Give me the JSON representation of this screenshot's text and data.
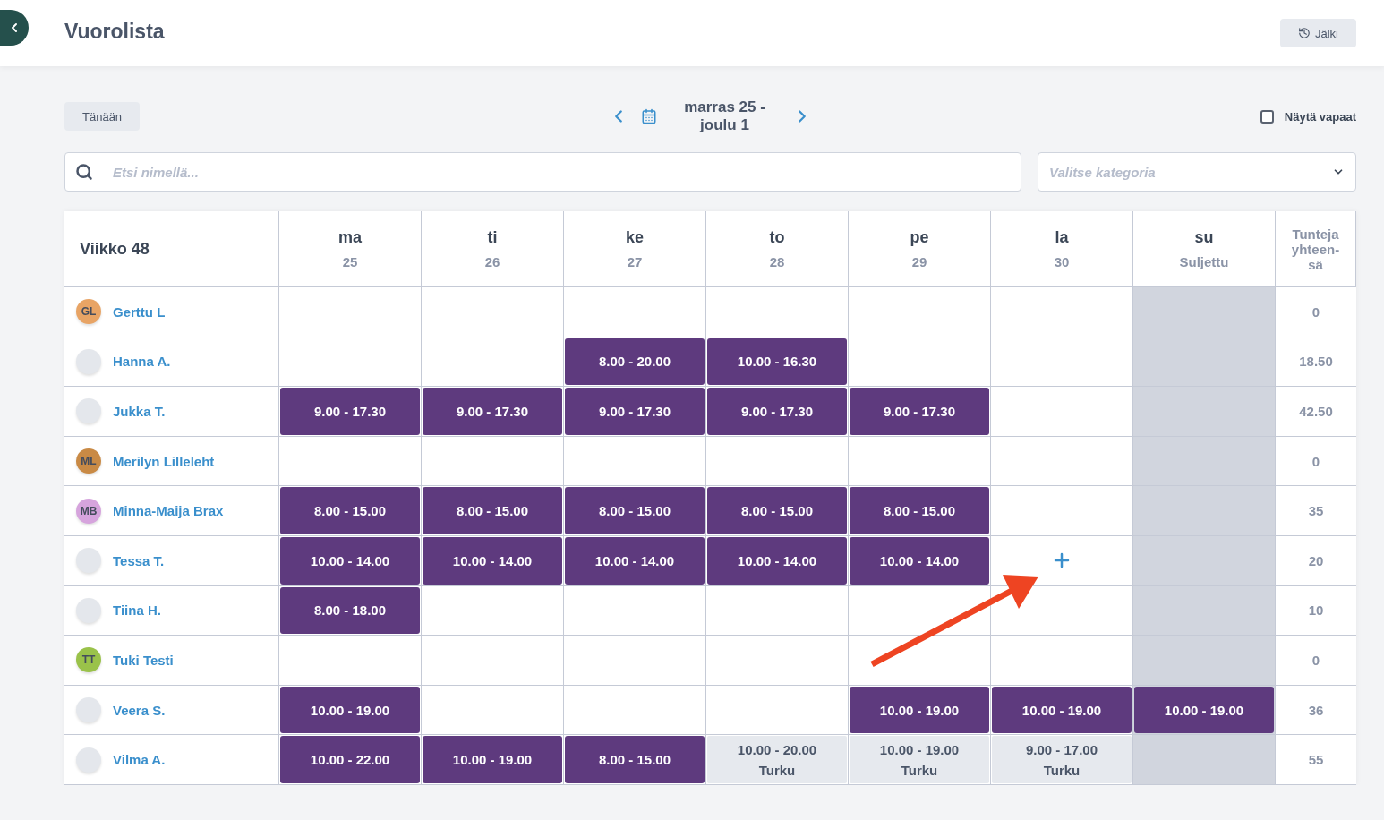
{
  "header": {
    "title": "Vuorolista",
    "history_button": "Jälki"
  },
  "toolbar": {
    "today_button": "Tänään",
    "date_range": [
      "marras 25 -",
      "joulu 1"
    ],
    "show_free": {
      "label": "Näytä vapaat",
      "checked": false
    }
  },
  "search": {
    "placeholder": "Etsi nimellä..."
  },
  "category_select": {
    "placeholder": "Valitse kategoria"
  },
  "table": {
    "week_label": "Viikko 48",
    "total_header": "Tunteja yhteen-sä",
    "days": [
      {
        "name": "ma",
        "sub": "25",
        "closed": false
      },
      {
        "name": "ti",
        "sub": "26",
        "closed": false
      },
      {
        "name": "ke",
        "sub": "27",
        "closed": false
      },
      {
        "name": "to",
        "sub": "28",
        "closed": false
      },
      {
        "name": "pe",
        "sub": "29",
        "closed": false
      },
      {
        "name": "la",
        "sub": "30",
        "closed": false
      },
      {
        "name": "su",
        "sub": "Suljettu",
        "closed": true
      }
    ],
    "rows": [
      {
        "name": "Gerttu L",
        "avatar": {
          "kind": "initials",
          "initials": "GL",
          "color": "#e8a465"
        },
        "cells": [
          null,
          null,
          null,
          null,
          null,
          null,
          null
        ],
        "total": "0"
      },
      {
        "name": "Hanna A.",
        "avatar": {
          "kind": "photo"
        },
        "cells": [
          null,
          null,
          {
            "kind": "shift",
            "time": "8.00 - 20.00"
          },
          {
            "kind": "shift",
            "time": "10.00 - 16.30"
          },
          null,
          null,
          null
        ],
        "total": "18.50"
      },
      {
        "name": "Jukka T.",
        "avatar": {
          "kind": "photo"
        },
        "cells": [
          {
            "kind": "shift",
            "time": "9.00 - 17.30"
          },
          {
            "kind": "shift",
            "time": "9.00 - 17.30"
          },
          {
            "kind": "shift",
            "time": "9.00 - 17.30"
          },
          {
            "kind": "shift",
            "time": "9.00 - 17.30"
          },
          {
            "kind": "shift",
            "time": "9.00 - 17.30"
          },
          null,
          null
        ],
        "total": "42.50"
      },
      {
        "name": "Merilyn Lilleleht",
        "avatar": {
          "kind": "initials",
          "initials": "ML",
          "color": "#c98a45"
        },
        "cells": [
          null,
          null,
          null,
          null,
          null,
          null,
          null
        ],
        "total": "0"
      },
      {
        "name": "Minna-Maija Brax",
        "avatar": {
          "kind": "initials",
          "initials": "MB",
          "color": "#d6a4dd"
        },
        "cells": [
          {
            "kind": "shift",
            "time": "8.00 - 15.00"
          },
          {
            "kind": "shift",
            "time": "8.00 - 15.00"
          },
          {
            "kind": "shift",
            "time": "8.00 - 15.00"
          },
          {
            "kind": "shift",
            "time": "8.00 - 15.00"
          },
          {
            "kind": "shift",
            "time": "8.00 - 15.00"
          },
          null,
          null
        ],
        "total": "35"
      },
      {
        "name": "Tessa T.",
        "avatar": {
          "kind": "photo"
        },
        "cells": [
          {
            "kind": "shift",
            "time": "10.00 - 14.00"
          },
          {
            "kind": "shift",
            "time": "10.00 - 14.00"
          },
          {
            "kind": "shift",
            "time": "10.00 - 14.00"
          },
          {
            "kind": "shift",
            "time": "10.00 - 14.00"
          },
          {
            "kind": "shift",
            "time": "10.00 - 14.00"
          },
          {
            "kind": "add"
          },
          null
        ],
        "total": "20"
      },
      {
        "name": "Tiina H.",
        "avatar": {
          "kind": "photo"
        },
        "cells": [
          {
            "kind": "shift",
            "time": "8.00 - 18.00"
          },
          null,
          null,
          null,
          null,
          null,
          null
        ],
        "total": "10"
      },
      {
        "name": "Tuki Testi",
        "avatar": {
          "kind": "initials",
          "initials": "TT",
          "color": "#9ac24a"
        },
        "cells": [
          null,
          null,
          null,
          null,
          null,
          null,
          null
        ],
        "total": "0"
      },
      {
        "name": "Veera S.",
        "avatar": {
          "kind": "photo"
        },
        "cells": [
          {
            "kind": "shift",
            "time": "10.00 - 19.00"
          },
          null,
          null,
          null,
          {
            "kind": "shift",
            "time": "10.00 - 19.00"
          },
          {
            "kind": "shift",
            "time": "10.00 - 19.00"
          },
          {
            "kind": "shift",
            "time": "10.00 - 19.00"
          }
        ],
        "total": "36"
      },
      {
        "name": "Vilma A.",
        "avatar": {
          "kind": "photo"
        },
        "cells": [
          {
            "kind": "shift",
            "time": "10.00 - 22.00"
          },
          {
            "kind": "shift",
            "time": "10.00 - 19.00"
          },
          {
            "kind": "shift",
            "time": "8.00 - 15.00"
          },
          {
            "kind": "other",
            "time": "10.00 - 20.00",
            "location": "Turku"
          },
          {
            "kind": "other",
            "time": "10.00 - 19.00",
            "location": "Turku"
          },
          {
            "kind": "other",
            "time": "9.00 - 17.00",
            "location": "Turku"
          },
          null
        ],
        "total": "55"
      }
    ]
  }
}
